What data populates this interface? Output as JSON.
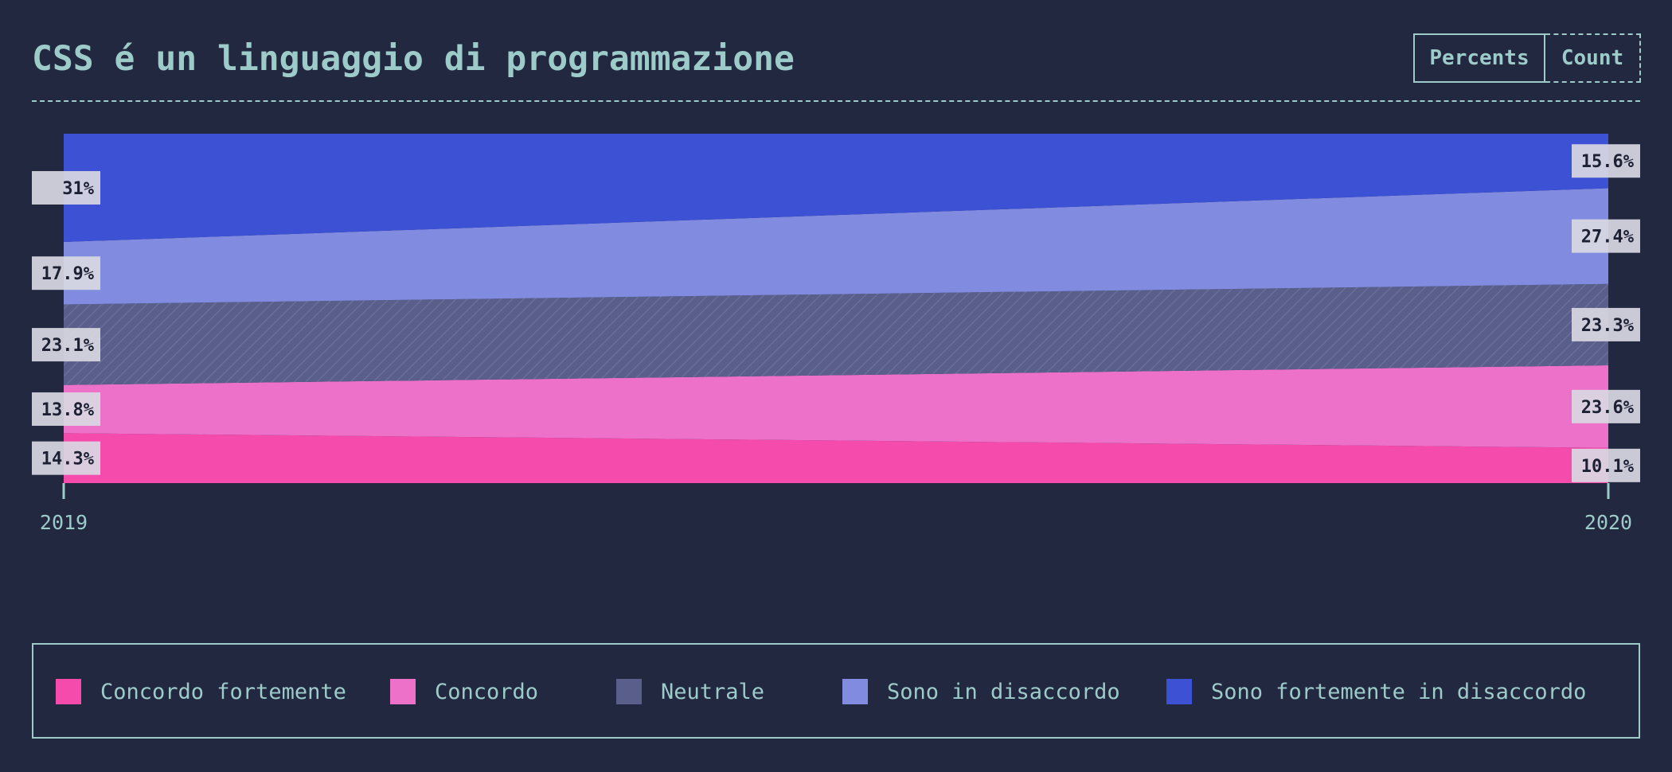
{
  "title": "CSS é un linguaggio di programmazione",
  "toggle": {
    "options": [
      "Percents",
      "Count"
    ],
    "selected": "Percents"
  },
  "colors": {
    "background": "#232841",
    "text": "#9dcbc9",
    "label_box": "#d8d8e2"
  },
  "chart_data": {
    "type": "area",
    "stacked": true,
    "normalized_percent": true,
    "x": [
      "2019",
      "2020"
    ],
    "ylim": [
      0,
      100
    ],
    "grid": false,
    "legend_position": "bottom",
    "series": [
      {
        "name": "Concordo fortemente",
        "color": "#f54bac",
        "values": [
          14.3,
          10.1
        ],
        "labels": [
          "14.3%",
          "10.1%"
        ]
      },
      {
        "name": "Concordo",
        "color": "#ed70c9",
        "values": [
          13.8,
          23.6
        ],
        "labels": [
          "13.8%",
          "23.6%"
        ]
      },
      {
        "name": "Neutrale",
        "color": "#595e8a",
        "hatched": true,
        "values": [
          23.1,
          23.3
        ],
        "labels": [
          "23.1%",
          "23.3%"
        ]
      },
      {
        "name": "Sono in disaccordo",
        "color": "#818ce0",
        "values": [
          17.9,
          27.4
        ],
        "labels": [
          "17.9%",
          "27.4%"
        ]
      },
      {
        "name": "Sono fortemente in disaccordo",
        "color": "#3d51d4",
        "values": [
          31,
          15.6
        ],
        "labels": [
          "31%",
          "15.6%"
        ]
      }
    ]
  }
}
